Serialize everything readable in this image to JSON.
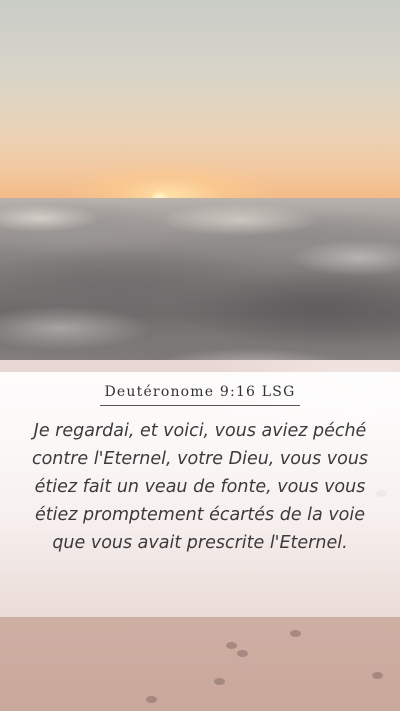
{
  "reference": "Deutéronome 9:16 LSG",
  "verse_text": "Je regardai, et voici, vous aviez péché contre l'Eternel, votre Dieu, vous vous étiez fait un veau de fonte, vous vous étiez promptement écartés de la voie que vous avait prescrite l'Eternel."
}
